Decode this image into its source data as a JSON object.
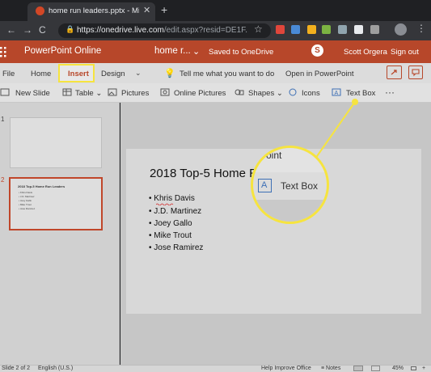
{
  "browser": {
    "tab_title": "home run leaders.pptx - Micro",
    "tab_close": "✕",
    "new_tab": "+",
    "url_host": "https://onedrive.live.com",
    "url_path": "/edit.aspx?resid=DE1F...",
    "back": "←",
    "forward": "→",
    "reload": "C",
    "lock": "🔒",
    "star": "☆",
    "menu": "⋮"
  },
  "app": {
    "name": "PowerPoint Online",
    "doc_name": "home r...",
    "doc_caret": "⌄",
    "save_status": "Saved to OneDrive",
    "skype": "S",
    "user": "Scott Orgera",
    "sign_out": "Sign out"
  },
  "ribbon": {
    "tabs": [
      "File",
      "Home",
      "Insert",
      "Design"
    ],
    "design_caret": "⌄",
    "tell_me": "Tell me what you want to do",
    "open_in": "Open in PowerPoint",
    "commands": {
      "new_slide": "New Slide",
      "table": "Table",
      "pictures": "Pictures",
      "online_pictures": "Online Pictures",
      "shapes": "Shapes",
      "icons": "Icons",
      "text_box": "Text Box",
      "more": "···"
    }
  },
  "thumbnails": {
    "numbers": [
      "1",
      "2"
    ],
    "mini_title": "2018 Top-5 Home Run Leaders",
    "mini_items": [
      "• Khris Davis",
      "• J.D. Martinez",
      "• Joey Gallo",
      "• Mike Trout",
      "• Jose Ramirez"
    ]
  },
  "slide": {
    "title": "2018 Top-5 Home R",
    "bullets": [
      "• Khris Davis",
      "• J.D. Martinez",
      "• Joey Gallo",
      "• Mike Trout",
      "• Jose Ramirez"
    ]
  },
  "magnifier": {
    "top_text": "oint",
    "icon_letter": "A",
    "label": "Text Box"
  },
  "status": {
    "slide": "Slide 2 of 2",
    "language": "English (U.S.)",
    "help": "Help Improve Office",
    "notes": "Notes",
    "zoom": "45%"
  },
  "colors": {
    "office_red": "#b7472a",
    "highlight_yellow": "#f6e43f"
  }
}
